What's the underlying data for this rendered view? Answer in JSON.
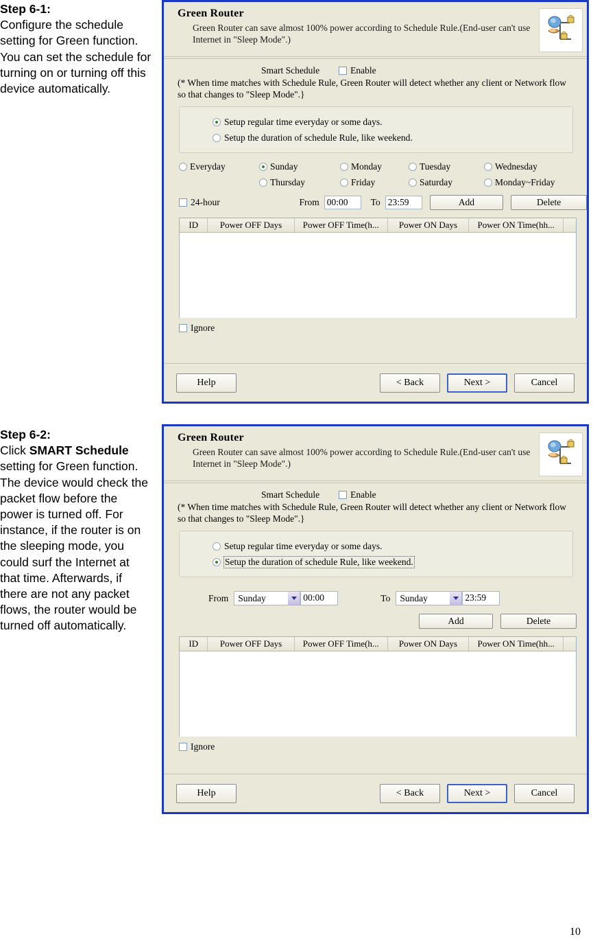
{
  "document": {
    "page_number": "10"
  },
  "steps": [
    {
      "heading": "Step 6-1:",
      "body": "Configure the schedule setting for Green function. You can set the schedule for turning on or turning off this device automatically."
    },
    {
      "heading": "Step 6-2:",
      "body_before_bold": "Click ",
      "bold": "SMART Schedule",
      "body_after_bold": " setting for Green function. The device would check the packet flow before the power is turned off. For instance, if the router is on the sleeping mode, you could surf the Internet at that time. Afterwards, if there are not any packet flows, the router would be turned off automatically."
    }
  ],
  "panel": {
    "title": "Green Router",
    "description": "Green Router can save almost 100% power according to Schedule Rule.(End-user can't use Internet in \"Sleep Mode\".)",
    "icon": "green-router-icon",
    "smart_schedule_label": "Smart Schedule",
    "enable_label": "Enable",
    "note": "(* When time matches with Schedule Rule, Green Router will detect whether any client or Network flow so that changes to \"Sleep Mode\".}",
    "mode_options": [
      "Setup regular time everyday or some days.",
      "Setup the duration of schedule Rule, like weekend."
    ],
    "days": [
      "Everyday",
      "Sunday",
      "Monday",
      "Tuesday",
      "Wednesday",
      "",
      "Thursday",
      "Friday",
      "Saturday",
      "Monday~Friday"
    ],
    "hour24_label": "24-hour",
    "from_label": "From",
    "to_label": "To",
    "time_from": "00:00",
    "time_to": "23:59",
    "add_label": "Add",
    "delete_label": "Delete",
    "table_headers": [
      "ID",
      "Power OFF Days",
      "Power OFF Time(h...",
      "Power ON Days",
      "Power ON Time(hh..."
    ],
    "table_rows": [],
    "ignore_label": "Ignore",
    "footer": {
      "help": "Help",
      "back": "< Back",
      "next": "Next >",
      "cancel": "Cancel"
    },
    "day_select_from": "Sunday",
    "day_select_to": "Sunday"
  },
  "colors": {
    "window_border": "#1c39c4",
    "panel_background": "#e9e8d9",
    "radio_selected": "#2a8a2a",
    "focus_button_border": "#3b63c9"
  }
}
